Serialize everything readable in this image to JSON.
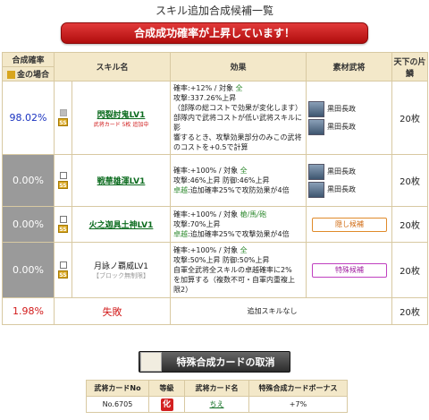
{
  "title": "スキル追加合成候補一覧",
  "banner": "合成成功確率が上昇しています！",
  "headers": {
    "rate": "合成確率",
    "kin_case": "金の場合",
    "skill_name": "スキル名",
    "effect": "効果",
    "materials": "素材武将",
    "tenka": "天下の片鱗"
  },
  "rows": [
    {
      "pct": "98.02%",
      "skill": "閃裂討鬼LV1",
      "sub": "武将カード 5枚 追加中",
      "effect_lines": [
        [
          "確率:+12% / 対象 ",
          "全"
        ],
        [
          "攻撃:337.26%上昇",
          ""
        ],
        [
          "（部隊の総コストで効果が変化します）",
          ""
        ],
        [
          "部隊内で武将コストが低い武将スキルに影",
          ""
        ],
        [
          "響するとき、攻撃効果部分のみこの武将",
          ""
        ],
        [
          "のコストを+0.5で計算",
          ""
        ]
      ],
      "materials": [
        "黒田長政",
        "黒田長政"
      ],
      "count": "20枚"
    },
    {
      "pct": "0.00%",
      "skill": "戦華雄渾LV1",
      "effect_lines": [
        [
          "確率:+100% / 対象 ",
          "全"
        ],
        [
          "攻撃:46%上昇 防御:46%上昇",
          ""
        ],
        [
          "卓越:追加確率25%で攻防効果が4倍",
          ""
        ]
      ],
      "materials": [
        "黒田長政",
        "黒田長政"
      ],
      "count": "20枚"
    },
    {
      "pct": "0.00%",
      "skill": "火之迦具土神LV1",
      "effect_lines": [
        [
          "確率:+100% / 対象 ",
          "槍/馬/砲"
        ],
        [
          "攻撃:70%上昇",
          ""
        ],
        [
          "卓越:追加確率25%で攻撃効果が4倍",
          ""
        ]
      ],
      "tag": "隠し候補",
      "count": "20枚"
    },
    {
      "pct": "0.00%",
      "skill": "月詠ノ覇威LV1",
      "sub2": "【ブロック無制限】",
      "effect_lines": [
        [
          "確率:+100% / 対象 ",
          "全"
        ],
        [
          "攻撃:50%上昇 防御:50%上昇",
          ""
        ],
        [
          "自軍全武将全スキルの卓越確率に2%",
          ""
        ],
        [
          "を加算する（複数不可・自軍内重複上",
          ""
        ],
        [
          "限2）",
          ""
        ]
      ],
      "tag": "特殊候補",
      "count": "20枚"
    }
  ],
  "fail": {
    "pct": "1.98%",
    "label": "失敗",
    "effect": "追加スキルなし",
    "count": "20枚"
  },
  "cancel_label": "特殊合成カードの取消",
  "card_table": {
    "headers": [
      "武将カードNo",
      "等級",
      "武将カード名",
      "特殊合成カードボーナス"
    ],
    "row": {
      "no": "No.6705",
      "grade": "化",
      "name": "ちえ",
      "bonus": "+7%"
    }
  }
}
